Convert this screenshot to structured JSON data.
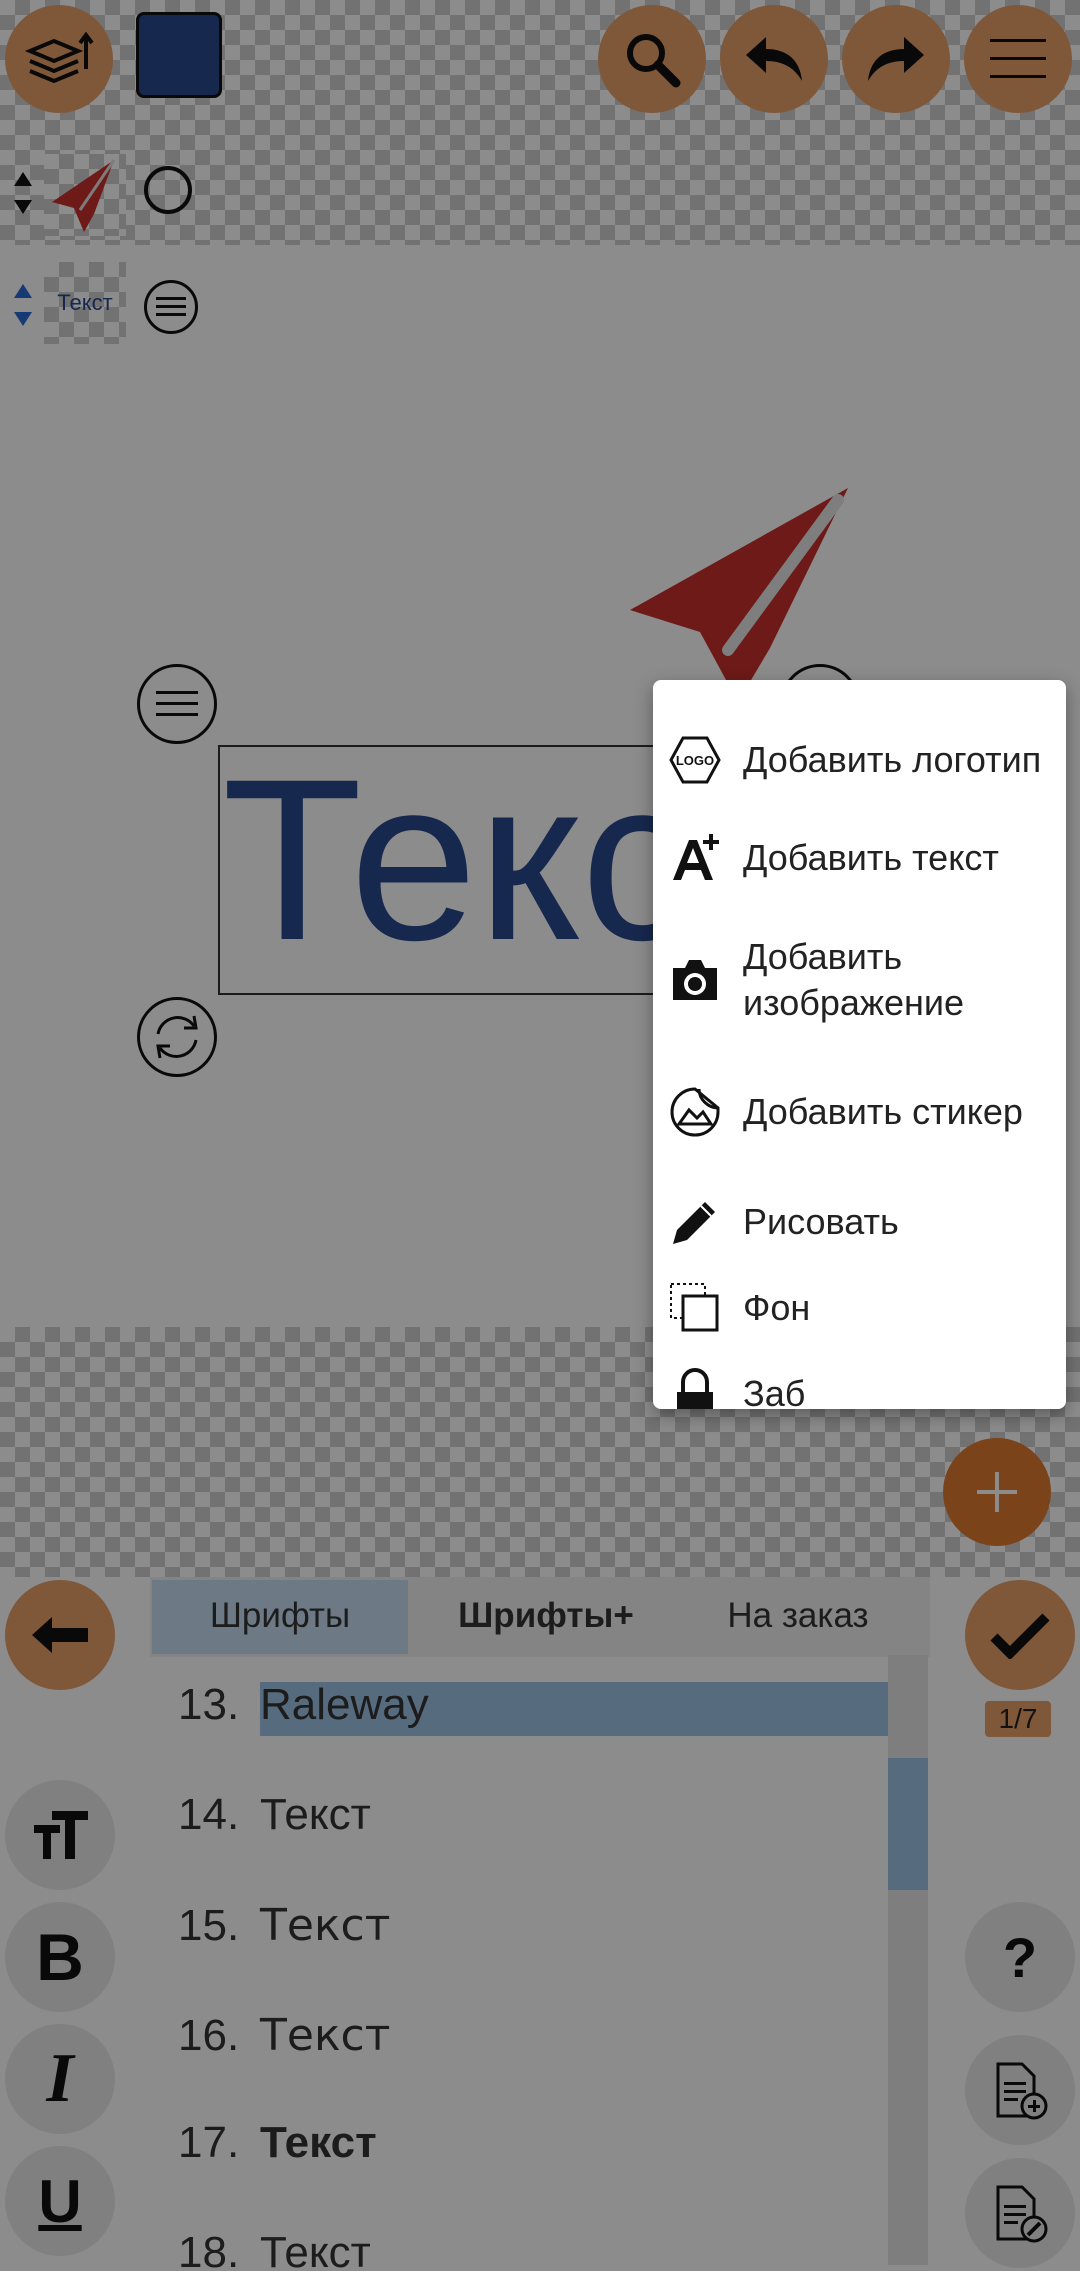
{
  "toolbar": {
    "layers_icon": "layers-icon",
    "color_swatch": "#2a4a8e",
    "search_icon": "search-icon",
    "undo_icon": "undo-icon",
    "redo_icon": "redo-icon",
    "menu_icon": "hamburger-icon"
  },
  "layers": [
    {
      "thumb": "paper-plane",
      "thumb_text": ""
    },
    {
      "thumb": "text",
      "thumb_text": "Текст"
    }
  ],
  "canvas": {
    "text": "Текст",
    "text_color": "#2a4a8e",
    "logo_color": "#c9302c"
  },
  "popup_menu": {
    "items": [
      {
        "label": "Добавить логотип",
        "icon": "logo-icon"
      },
      {
        "label": "Добавить текст",
        "icon": "add-text-icon"
      },
      {
        "label": "Добавить изображение",
        "icon": "camera-icon"
      },
      {
        "label": "Добавить стикер",
        "icon": "sticker-icon"
      },
      {
        "label": "Рисовать",
        "icon": "pencil-icon"
      },
      {
        "label": "Фон",
        "icon": "background-icon"
      },
      {
        "label": "Заб",
        "icon": "lock-icon"
      }
    ]
  },
  "fab": {
    "icon": "plus-icon"
  },
  "font_panel": {
    "tabs": [
      {
        "label": "Шрифты"
      },
      {
        "label": "Шрифты+"
      },
      {
        "label": "На заказ"
      }
    ],
    "fonts": [
      {
        "num": "13.",
        "name": "Raleway"
      },
      {
        "num": "14.",
        "name": "Текст"
      },
      {
        "num": "15.",
        "name": "Текст"
      },
      {
        "num": "16.",
        "name": "Текст"
      },
      {
        "num": "17.",
        "name": "Текст"
      },
      {
        "num": "18.",
        "name": "Текст"
      }
    ],
    "page_indicator": "1/7"
  },
  "side_tools": {
    "back": "back-arrow-icon",
    "text_size": "text-size-icon",
    "bold": "B",
    "italic": "I",
    "underline": "U",
    "confirm": "checkmark-icon",
    "help": "?",
    "add_page": "add-page-icon",
    "edit_page": "edit-page-icon"
  },
  "accent_colors": {
    "orange": "#e8a06a",
    "highlight": "#9fc4e8"
  }
}
